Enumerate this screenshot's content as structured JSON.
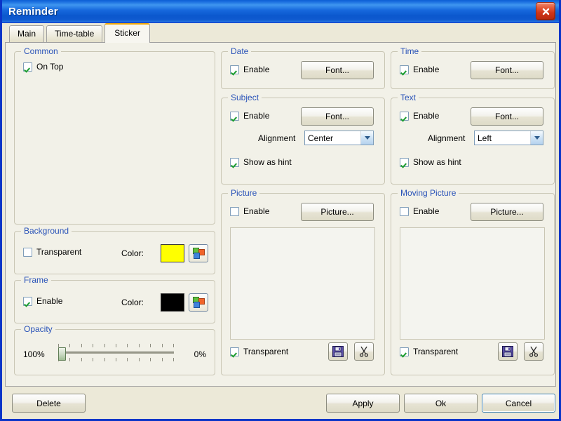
{
  "window": {
    "title": "Reminder",
    "close_icon": "close-icon"
  },
  "tabs": [
    {
      "label": "Main",
      "active": false
    },
    {
      "label": "Time-table",
      "active": false
    },
    {
      "label": "Sticker",
      "active": true
    }
  ],
  "groups": {
    "common": {
      "caption": "Common",
      "on_top": {
        "label": "On Top",
        "checked": true
      }
    },
    "background": {
      "caption": "Background",
      "transparent": {
        "label": "Transparent",
        "checked": false
      },
      "color_label": "Color:",
      "color_value": "#ffff00",
      "picker_icon": "color-picker-icon"
    },
    "frame": {
      "caption": "Frame",
      "enable": {
        "label": "Enable",
        "checked": true
      },
      "color_label": "Color:",
      "color_value": "#000000",
      "picker_icon": "color-picker-icon"
    },
    "opacity": {
      "caption": "Opacity",
      "left_value": "100%",
      "right_value": "0%",
      "slider_position_percent": 0
    },
    "date": {
      "caption": "Date",
      "enable": {
        "label": "Enable",
        "checked": true
      },
      "font_button": "Font..."
    },
    "subject": {
      "caption": "Subject",
      "enable": {
        "label": "Enable",
        "checked": true
      },
      "font_button": "Font...",
      "alignment_label": "Alignment",
      "alignment_value": "Center",
      "show_as_hint": {
        "label": "Show as hint",
        "checked": true
      }
    },
    "picture": {
      "caption": "Picture",
      "enable": {
        "label": "Enable",
        "checked": false
      },
      "picture_button": "Picture...",
      "transparent": {
        "label": "Transparent",
        "checked": true
      },
      "save_icon": "save-floppy-icon",
      "cut_icon": "scissors-icon"
    },
    "time": {
      "caption": "Time",
      "enable": {
        "label": "Enable",
        "checked": true
      },
      "font_button": "Font..."
    },
    "text": {
      "caption": "Text",
      "enable": {
        "label": "Enable",
        "checked": true
      },
      "font_button": "Font...",
      "alignment_label": "Alignment",
      "alignment_value": "Left",
      "show_as_hint": {
        "label": "Show as hint",
        "checked": true
      }
    },
    "moving_picture": {
      "caption": "Moving Picture",
      "enable": {
        "label": "Enable",
        "checked": false
      },
      "picture_button": "Picture...",
      "transparent": {
        "label": "Transparent",
        "checked": true
      },
      "save_icon": "save-floppy-icon",
      "cut_icon": "scissors-icon"
    }
  },
  "footer": {
    "delete": "Delete",
    "apply": "Apply",
    "ok": "Ok",
    "cancel": "Cancel"
  },
  "colors": {
    "titlebar_blue": "#1b6fe0",
    "group_caption": "#2a53b8",
    "tab_accent": "#f0a80a",
    "dialog_face": "#ece9d8",
    "tabpage_face": "#f2f1e8",
    "checkmark_green": "#1a9c2e",
    "close_red": "#cf3418"
  }
}
